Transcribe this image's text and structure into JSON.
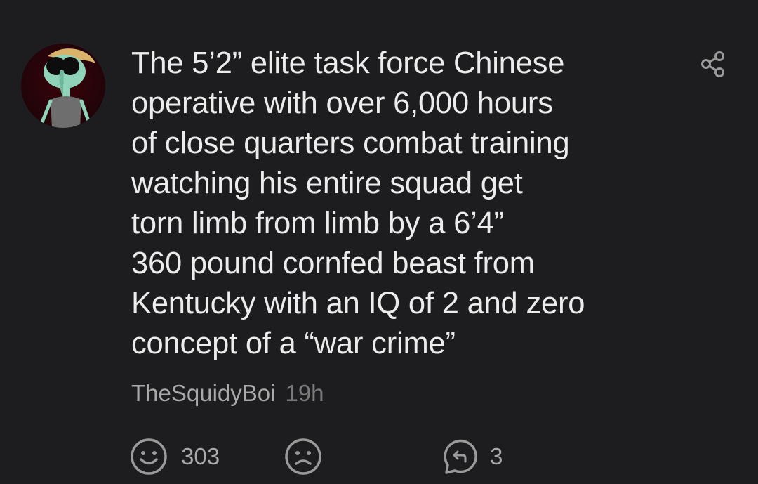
{
  "post": {
    "text": "The 5’2” elite task force Chinese\noperative with over 6,000 hours\nof close quarters combat training\nwatching his entire squad get\ntorn limb from limb by a 6’4”\n360 pound cornfed beast from\nKentucky with an IQ of 2 and zero\nconcept of a “war crime”",
    "username": "TheSquidyBoi",
    "time": "19h"
  },
  "actions": {
    "like_count": "303",
    "reply_count": "3"
  },
  "icons": {
    "share": "share-icon",
    "like": "smile-icon",
    "dislike": "frown-icon",
    "reply": "reply-icon",
    "avatar": "avatar-illustration"
  },
  "colors": {
    "background": "#1d1d1f",
    "text": "#ececec",
    "meta": "#a9a9a9",
    "icon": "#9a9a9a"
  }
}
